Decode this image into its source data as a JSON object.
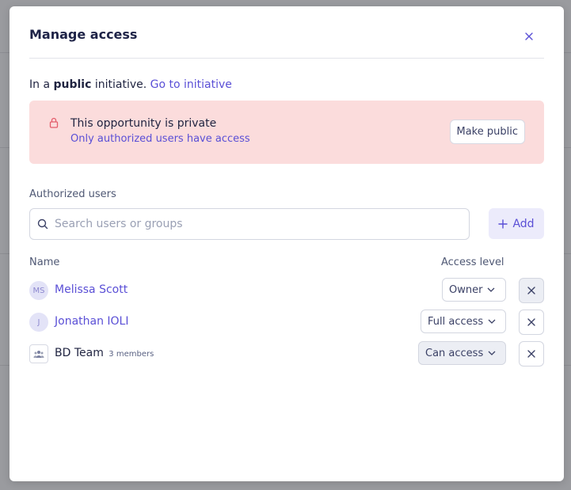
{
  "modal": {
    "title": "Manage access",
    "close_icon": "close-icon"
  },
  "initiative": {
    "prefix": "In a ",
    "visibility": "public",
    "suffix": " initiative. ",
    "link": "Go to initiative"
  },
  "private_notice": {
    "icon": "lock-icon",
    "title": "This opportunity is private",
    "subtitle": "Only authorized users have access",
    "button": "Make public"
  },
  "authorized": {
    "label": "Authorized users",
    "search_placeholder": "Search users or groups",
    "search_value": "",
    "add_label": "Add"
  },
  "table": {
    "col_name": "Name",
    "col_access": "Access level",
    "rows": [
      {
        "initials": "MS",
        "name": "Melissa Scott",
        "access": "Owner",
        "type": "user"
      },
      {
        "initials": "J",
        "name": "Jonathan IOLI",
        "access": "Full access",
        "type": "user"
      },
      {
        "name": "BD Team",
        "members": "3 members",
        "access": "Can access",
        "type": "group"
      }
    ]
  },
  "colors": {
    "accent": "#5a4fd6",
    "notice_bg": "#fbdcdc",
    "title": "#1e2347"
  }
}
